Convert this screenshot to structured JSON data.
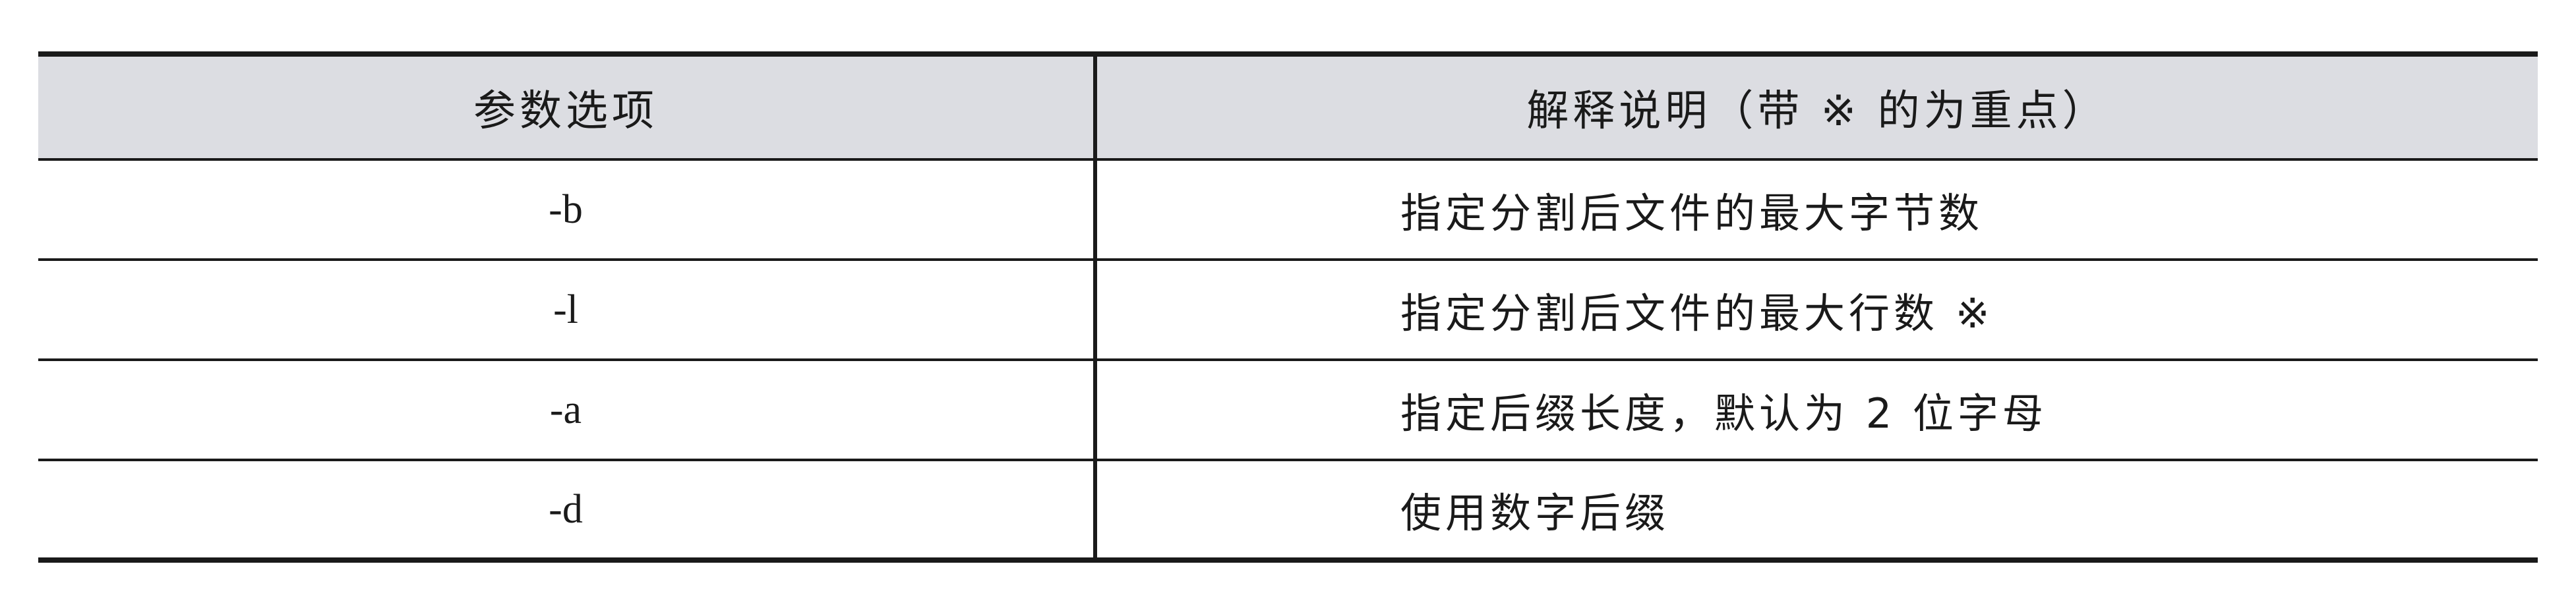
{
  "table": {
    "headers": {
      "option": "参数选项",
      "description": "解释说明（带 ※ 的为重点）"
    },
    "rows": [
      {
        "option": "-b",
        "description": "指定分割后文件的最大字节数"
      },
      {
        "option": "-l",
        "description": "指定分割后文件的最大行数 ※"
      },
      {
        "option": "-a",
        "description": "指定后缀长度，默认为 2 位字母"
      },
      {
        "option": "-d",
        "description": "使用数字后缀"
      }
    ]
  }
}
